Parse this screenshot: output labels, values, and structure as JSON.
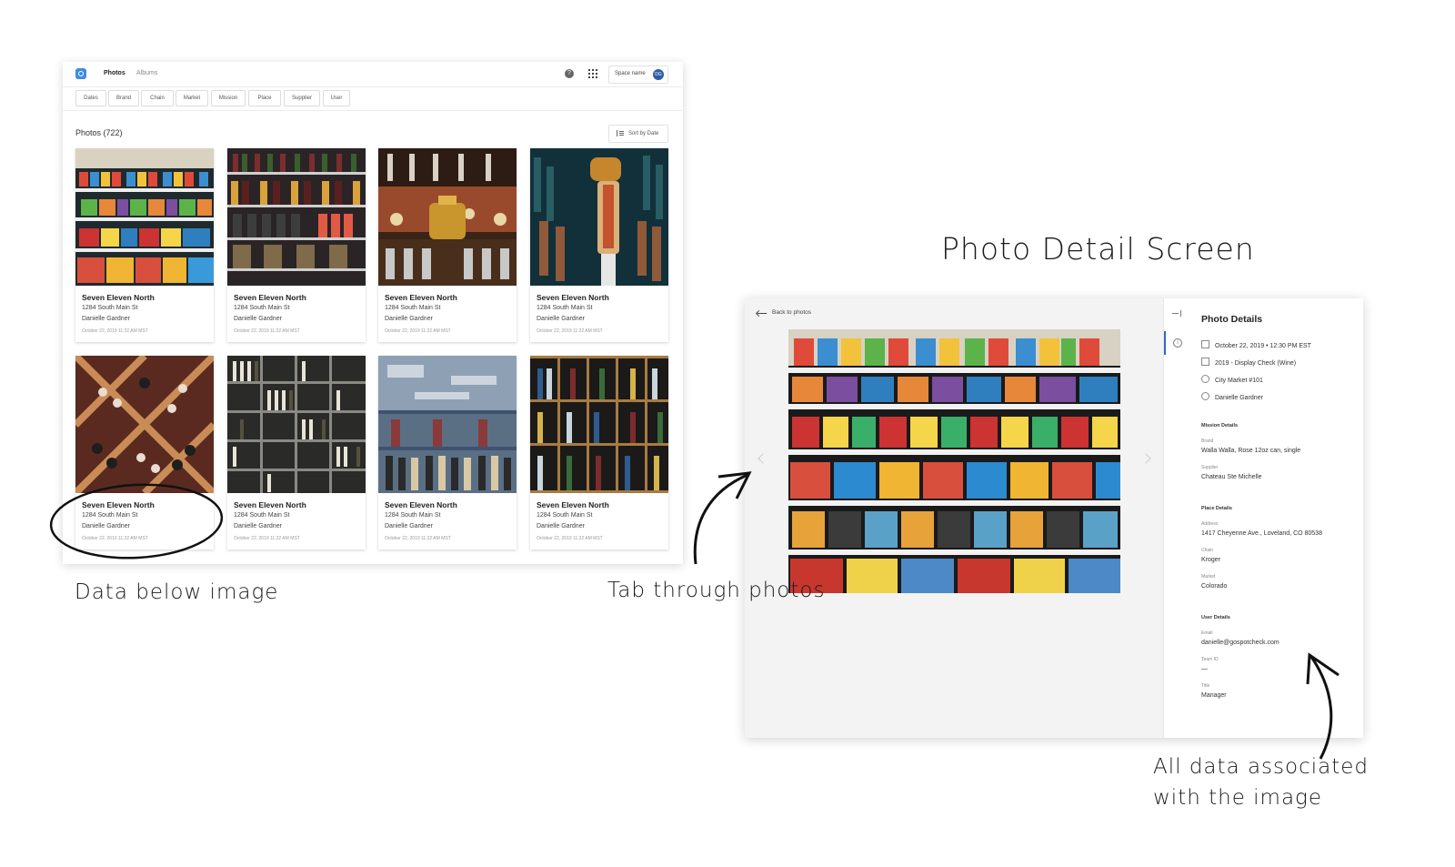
{
  "annotations": {
    "detail_heading": "Photo Detail Screen",
    "data_below": "Data below image",
    "tab_through": "Tab through photos",
    "all_data_line1": "All data associated",
    "all_data_line2": "with the image"
  },
  "grid_window": {
    "nav": {
      "photos": "Photos",
      "albums": "Albums"
    },
    "help_glyph": "?",
    "space": {
      "name": "Space name",
      "initials": "DG"
    },
    "filters": [
      "Dates",
      "Brand",
      "Chain",
      "Market",
      "Mission",
      "Place",
      "Supplier",
      "User"
    ],
    "heading": "Photos (722)",
    "sort_label": "Sort by Date",
    "cards": [
      {
        "title": "Seven Eleven North",
        "address": "1284 South Main St",
        "user": "Danielle Gardner",
        "date": "October 22, 2019 11:22 AM MST"
      },
      {
        "title": "Seven Eleven North",
        "address": "1284 South Main St",
        "user": "Danielle Gardner",
        "date": "October 22, 2019 11:22 AM MST"
      },
      {
        "title": "Seven Eleven North",
        "address": "1284 South Main St",
        "user": "Danielle Gardner",
        "date": "October 22, 2019 11:22 AM MST"
      },
      {
        "title": "Seven Eleven North",
        "address": "1284 South Main St",
        "user": "Danielle Gardner",
        "date": "October 22, 2019 11:22 AM MST"
      },
      {
        "title": "Seven Eleven North",
        "address": "1284 South Main St",
        "user": "Danielle Gardner",
        "date": "October 22, 2019 11:22 AM MST"
      },
      {
        "title": "Seven Eleven North",
        "address": "1284 South Main St",
        "user": "Danielle Gardner",
        "date": "October 22, 2019 11:22 AM MST"
      },
      {
        "title": "Seven Eleven North",
        "address": "1284 South Main St",
        "user": "Danielle Gardner",
        "date": "October 22, 2019 11:22 AM MST"
      },
      {
        "title": "Seven Eleven North",
        "address": "1284 South Main St",
        "user": "Danielle Gardner",
        "date": "October 22, 2019 11:22 AM MST"
      }
    ]
  },
  "detail_window": {
    "back_label": "Back to photos",
    "panel_title": "Photo Details",
    "summary": {
      "datetime": "October 22, 2019 • 12:30 PM EST",
      "mission": "2019 - Display Check (Wine)",
      "place": "City Market #101",
      "user": "Danielle Gardner"
    },
    "mission_details": {
      "heading": "Mission Details",
      "brand_label": "Brand",
      "brand_value": "Walla Walla, Rose 12oz can, single",
      "supplier_label": "Supplier",
      "supplier_value": "Chateau Ste Michelle"
    },
    "place_details": {
      "heading": "Place Details",
      "address_label": "Address",
      "address_value": "1417 Cheyenne Ave., Loveland, CO 80538",
      "chain_label": "Chain",
      "chain_value": "Kroger",
      "market_label": "Market",
      "market_value": "Colorado"
    },
    "user_details": {
      "heading": "User Details",
      "email_label": "Email",
      "email_value": "danielle@gospotcheck.com",
      "team_label": "Team ID",
      "team_value": "—",
      "title_label": "Title",
      "title_value": "Manager"
    }
  },
  "colors": {
    "accent": "#3366cc",
    "logo": "#3d8be6",
    "avatar": "#2d5fa8"
  }
}
